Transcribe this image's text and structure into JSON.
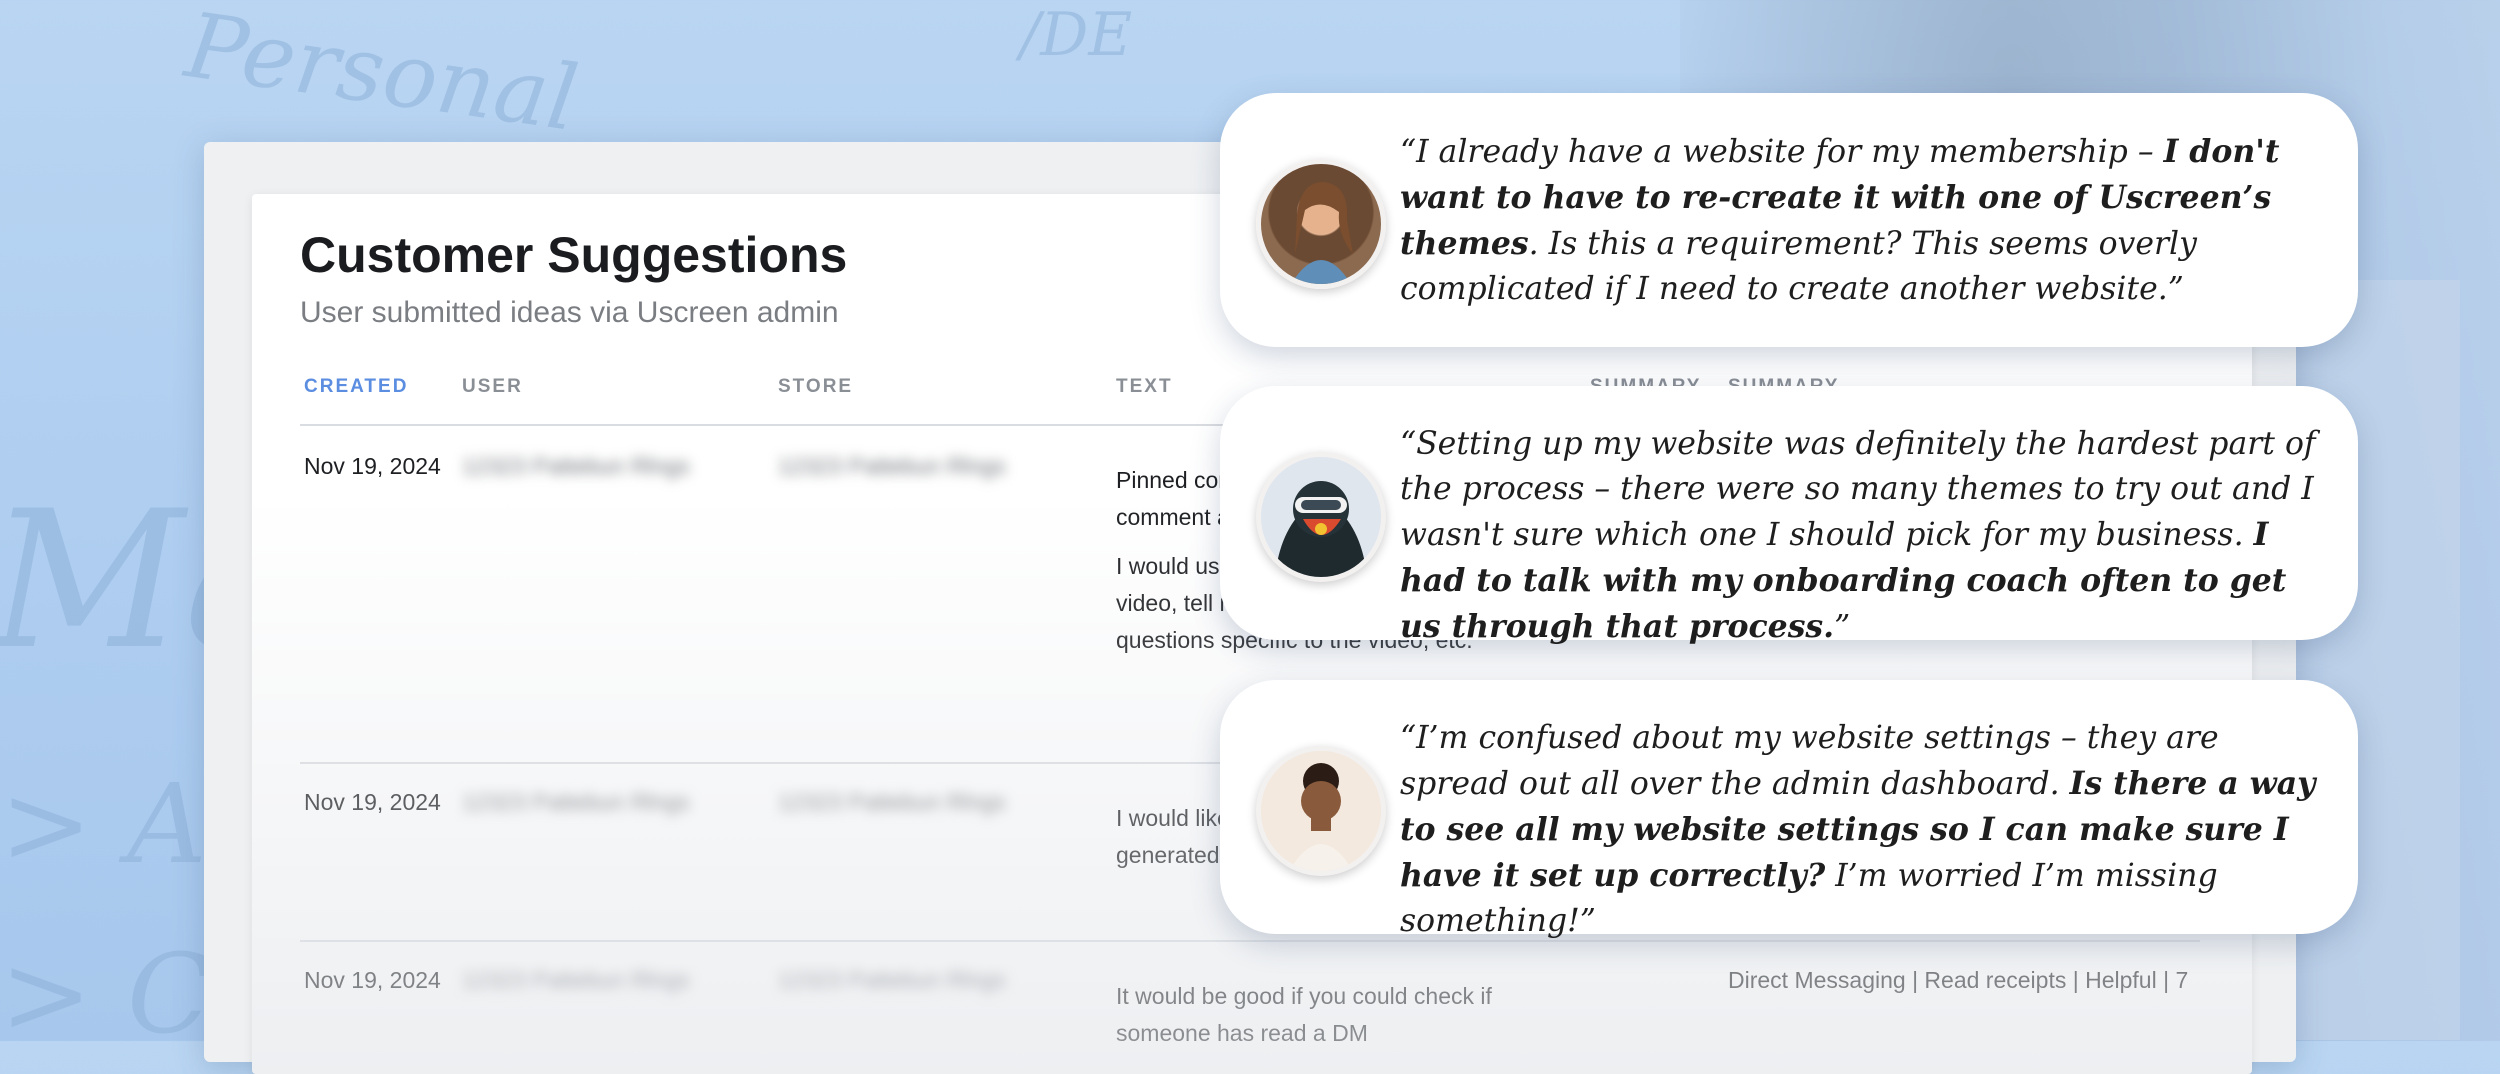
{
  "page": {
    "title": "Customer Suggestions",
    "subtitle": "User submitted ideas via Uscreen admin"
  },
  "table": {
    "headers": {
      "created": "CREATED",
      "user": "USER",
      "store": "STORE",
      "text": "TEXT",
      "summary1": "SUMMARY",
      "summary2": "SUMMARY"
    },
    "rows": [
      {
        "created": "Nov 19, 2024",
        "user": "12323 Pattebun Rlngs",
        "store": "12323 Pattebun Rlngs",
        "text_p1": "Pinned comments - I would like to pin a comment at the top of a video.",
        "text_p2": "I would use this to give info or more in a video, tell my audience to only ask questions specific to the video, etc.",
        "summary": ""
      },
      {
        "created": "Nov 19, 2024",
        "user": "12323 Pattebun Rlngs",
        "store": "12323 Pattebun Rlngs",
        "text_p1": "I would like to be able to see user-generated content that gets uploaded.",
        "text_p2": "",
        "summary": ""
      },
      {
        "created": "Nov 19, 2024",
        "user": "12323 Pattebun Rlngs",
        "store": "12323 Pattebun Rlngs",
        "text_p1": "It would be good if you could check if someone has read a DM",
        "text_p2": "",
        "summary": "Direct Messaging | Read receipts | Helpful | 7"
      }
    ]
  },
  "quotes": [
    {
      "pre": "“I already have a website for my membership – ",
      "bold": "I don't want to have to re-create it with one of Uscreen’s themes",
      "post": ". Is this a requirement? This seems overly complicated if I need to create another website.”"
    },
    {
      "pre": "“Setting up my website was definitely the hardest part of the process – there were so many themes to try out and I wasn't sure which one I should pick for my business. ",
      "bold": "I had to talk with my onboarding coach often to get us through that process.",
      "post": "”"
    },
    {
      "pre": "“I’m confused about my website settings – they are spread out all over the admin dashboard. ",
      "bold": "Is there a way to see all my website settings so I can make sure I have it set up correctly?",
      "post": " I’m worried I’m missing something!”"
    }
  ],
  "background": {
    "scribbles": [
      "Personal",
      "/DE",
      "Mark",
      "> A",
      "> C"
    ]
  },
  "colors": {
    "accent": "#5b8de0",
    "background": "#b9d5f2",
    "card": "#ffffff"
  }
}
